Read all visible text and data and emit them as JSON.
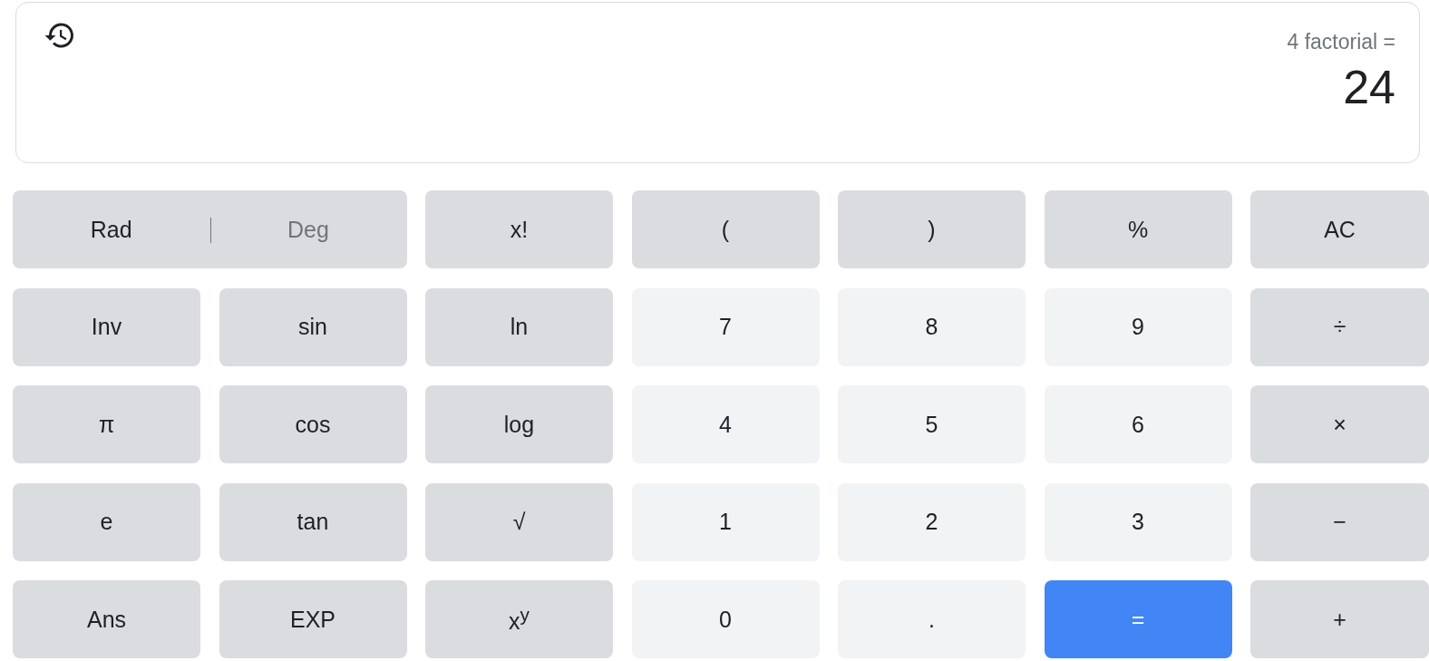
{
  "display": {
    "expression": "4 factorial =",
    "result": "24"
  },
  "angle_modes": [
    {
      "label": "Rad",
      "selected": true
    },
    {
      "label": "Deg",
      "selected": false
    }
  ],
  "keys": [
    {
      "label": "x!",
      "kind": "function"
    },
    {
      "label": "(",
      "kind": "function"
    },
    {
      "label": ")",
      "kind": "function"
    },
    {
      "label": "%",
      "kind": "function"
    },
    {
      "label": "AC",
      "kind": "function"
    },
    {
      "label": "Inv",
      "kind": "function"
    },
    {
      "label": "sin",
      "kind": "function"
    },
    {
      "label": "ln",
      "kind": "function"
    },
    {
      "label": "7",
      "kind": "digit"
    },
    {
      "label": "8",
      "kind": "digit"
    },
    {
      "label": "9",
      "kind": "digit"
    },
    {
      "label": "÷",
      "kind": "function"
    },
    {
      "label": "π",
      "kind": "function"
    },
    {
      "label": "cos",
      "kind": "function"
    },
    {
      "label": "log",
      "kind": "function"
    },
    {
      "label": "4",
      "kind": "digit"
    },
    {
      "label": "5",
      "kind": "digit"
    },
    {
      "label": "6",
      "kind": "digit"
    },
    {
      "label": "×",
      "kind": "function"
    },
    {
      "label": "e",
      "kind": "function"
    },
    {
      "label": "tan",
      "kind": "function"
    },
    {
      "label": "√",
      "kind": "function"
    },
    {
      "label": "1",
      "kind": "digit"
    },
    {
      "label": "2",
      "kind": "digit"
    },
    {
      "label": "3",
      "kind": "digit"
    },
    {
      "label": "−",
      "kind": "function"
    },
    {
      "label": "Ans",
      "kind": "function"
    },
    {
      "label": "EXP",
      "kind": "function"
    },
    {
      "label": "x$^{y}$",
      "kind": "function"
    },
    {
      "label": "0",
      "kind": "digit"
    },
    {
      "label": ".",
      "kind": "digit"
    },
    {
      "label": "=",
      "kind": "equals"
    },
    {
      "label": "+",
      "kind": "function"
    }
  ]
}
